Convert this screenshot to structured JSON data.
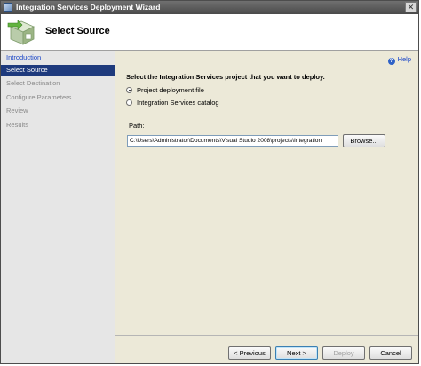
{
  "window": {
    "title": "Integration Services Deployment Wizard",
    "close_glyph": "✕"
  },
  "header": {
    "page_title": "Select Source"
  },
  "sidebar": {
    "items": [
      {
        "label": "Introduction",
        "state": "link"
      },
      {
        "label": "Select Source",
        "state": "active"
      },
      {
        "label": "Select Destination",
        "state": "disabled"
      },
      {
        "label": "Configure Parameters",
        "state": "disabled"
      },
      {
        "label": "Review",
        "state": "disabled"
      },
      {
        "label": "Results",
        "state": "disabled"
      }
    ]
  },
  "main": {
    "help_label": "Help",
    "help_glyph": "?",
    "instruction": "Select the Integration Services project that you want to deploy.",
    "options": [
      {
        "label": "Project deployment file",
        "checked": true
      },
      {
        "label": "Integration Services catalog",
        "checked": false
      }
    ],
    "path_label": "Path:",
    "path_value": "C:\\Users\\Administrator\\Documents\\Visual Studio 2008\\projects\\Integration",
    "browse_label": "Browse..."
  },
  "footer": {
    "previous_label": "< Previous",
    "next_label": "Next >",
    "deploy_label": "Deploy",
    "cancel_label": "Cancel"
  },
  "colors": {
    "nav_active_bg": "#1e3a7d",
    "link": "#1a46c8",
    "titlebar": "#5a5a5a"
  }
}
